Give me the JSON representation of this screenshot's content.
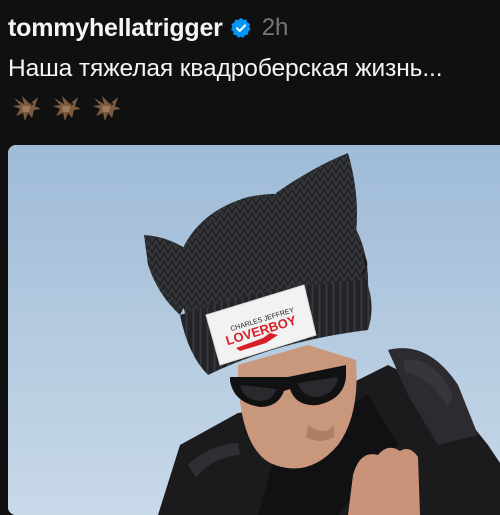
{
  "post": {
    "username": "tommyhellatrigger",
    "timestamp": "2h",
    "text": "Наша тяжелая квадроберская жизнь...",
    "emojis": [
      "dragon-icon",
      "dragon-icon",
      "dragon-icon"
    ]
  },
  "photo": {
    "patch_brand": "CHARLES JEFFREY",
    "patch_title": "LOVERBOY",
    "colors": {
      "sky_top": "#9fbbd7",
      "sky_bottom": "#c8d9e8",
      "beanie": "#26272a",
      "patch_red": "#d8202a"
    }
  },
  "colors": {
    "background": "#101010",
    "text_primary": "#f3f5f7",
    "text_secondary": "#777777",
    "verified_blue": "#0095f6"
  }
}
